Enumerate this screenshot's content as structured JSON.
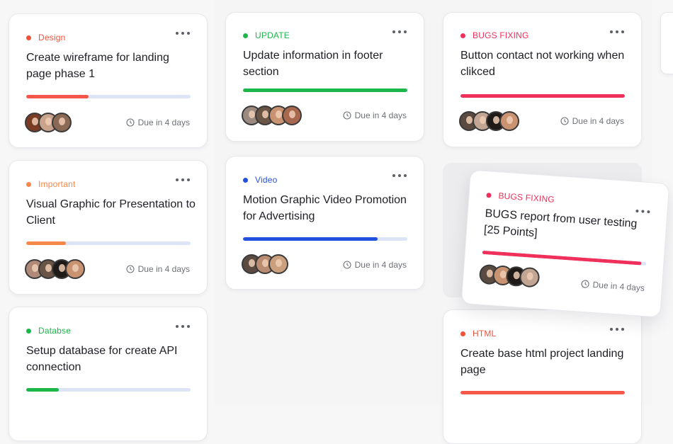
{
  "due_icon": "clock-icon",
  "more_icon": "more-dots-icon",
  "cards": [
    {
      "tag": "Design",
      "tag_color": "#f3513a",
      "title": "Create wireframe for landing page phase 1",
      "progress": 0.38,
      "bar_color": "#f5574a",
      "due": "Due in 4 days"
    },
    {
      "tag": "Important",
      "tag_color": "#f7884a",
      "title": "Visual Graphic for Presentation to Client",
      "progress": 0.24,
      "bar_color": "#f7884a",
      "due": "Due in 4 days"
    },
    {
      "tag": "Databse",
      "tag_color": "#1cb74a",
      "title": "Setup database for create API connection",
      "progress": 0.2,
      "bar_color": "#1cb74a",
      "due": ""
    },
    {
      "tag": "UPDATE",
      "tag_color": "#1cb74a",
      "title": "Update information in footer section",
      "progress": 1.0,
      "bar_color": "#1cb74a",
      "due": "Due in 4 days"
    },
    {
      "tag": "Video",
      "tag_color": "#2251e0",
      "title": "Motion Graphic Video Promotion for Advertising",
      "progress": 0.82,
      "bar_color": "#2251e0",
      "due": "Due in 4 days"
    },
    {
      "tag": "BUGS FIXING",
      "tag_color": "#f0305a",
      "title": "Button contact not working when clikced",
      "progress": 1.0,
      "bar_color": "#f0305a",
      "due": "Due in 4 days"
    },
    {
      "tag": "BUGS FIXING",
      "tag_color": "#f0305a",
      "title": "BUGS report from user testing [25 Points]",
      "progress": 0.97,
      "bar_color": "#f0305a",
      "due": "Due in 4 days"
    },
    {
      "tag": "HTML",
      "tag_color": "#f3513a",
      "title": "Create base html project landing page",
      "progress": 1.0,
      "bar_color": "#f5574a",
      "due": ""
    }
  ]
}
